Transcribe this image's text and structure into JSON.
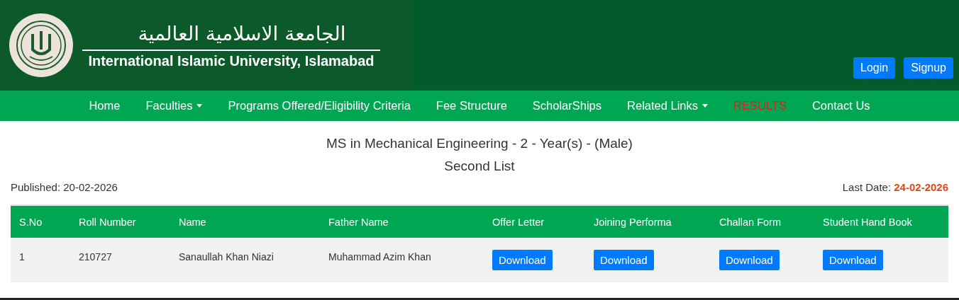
{
  "header": {
    "arabic_title": "الجامعة الاسلامية العالمية",
    "title": "International Islamic University, Islamabad",
    "buttons": [
      {
        "label": "Login"
      },
      {
        "label": "Signup"
      }
    ]
  },
  "nav": [
    {
      "label": "Home",
      "dropdown": false,
      "kind": "link"
    },
    {
      "label": "Faculties",
      "dropdown": true,
      "kind": "link"
    },
    {
      "label": "Programs Offered/Eligibility Criteria",
      "dropdown": false,
      "kind": "link"
    },
    {
      "label": "Fee Structure",
      "dropdown": false,
      "kind": "link"
    },
    {
      "label": "ScholarShips",
      "dropdown": false,
      "kind": "link"
    },
    {
      "label": "Related Links",
      "dropdown": true,
      "kind": "link"
    },
    {
      "label": "RESULTS",
      "dropdown": false,
      "kind": "highlight"
    },
    {
      "label": "Contact Us",
      "dropdown": false,
      "kind": "link"
    }
  ],
  "program_title": "MS in Mechanical Engineering - 2 - Year(s) - (Male)",
  "list_title": "Second List",
  "published": {
    "label": "Published:",
    "value": "20-02-2026"
  },
  "last_date": {
    "label": "Last Date:",
    "value": "24-02-2026"
  },
  "table": {
    "columns": [
      "S.No",
      "Roll Number",
      "Name",
      "Father Name",
      "Offer Letter",
      "Joining Performa",
      "Challan Form",
      "Student Hand Book"
    ],
    "rows": [
      {
        "cells": [
          {
            "kind": "text",
            "text": "1"
          },
          {
            "kind": "text",
            "text": "210727"
          },
          {
            "kind": "text",
            "text": "Sanaullah Khan Niazi"
          },
          {
            "kind": "text",
            "text": "Muhammad Azim Khan"
          },
          {
            "kind": "button",
            "text": "Download"
          },
          {
            "kind": "button",
            "text": "Download"
          },
          {
            "kind": "button",
            "text": "Download"
          },
          {
            "kind": "button",
            "text": "Download"
          }
        ]
      }
    ]
  }
}
